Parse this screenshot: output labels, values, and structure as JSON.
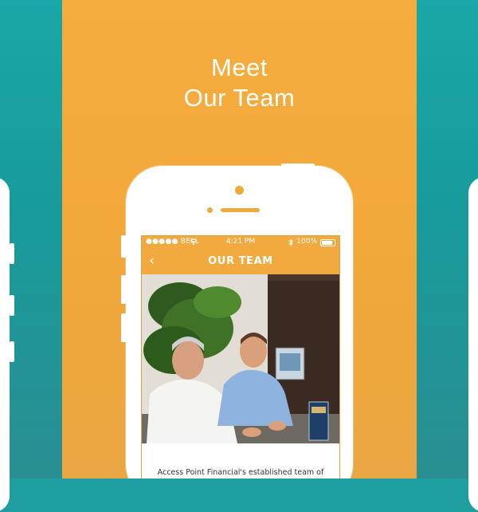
{
  "panel": {
    "title_line1": "Meet",
    "title_line2": "Our Team"
  },
  "status_bar": {
    "carrier": "●●●●● BELL",
    "time": "4:21 PM",
    "battery": "100%"
  },
  "nav": {
    "back_icon": "back-chevron-icon",
    "title": "OUR TEAM"
  },
  "content": {
    "photo": "team-photo",
    "intro_text": "Access Point Financial's established team of"
  },
  "colors": {
    "orange": "#f4a93a",
    "teal": "#1aa7a8",
    "white": "#ffffff"
  }
}
